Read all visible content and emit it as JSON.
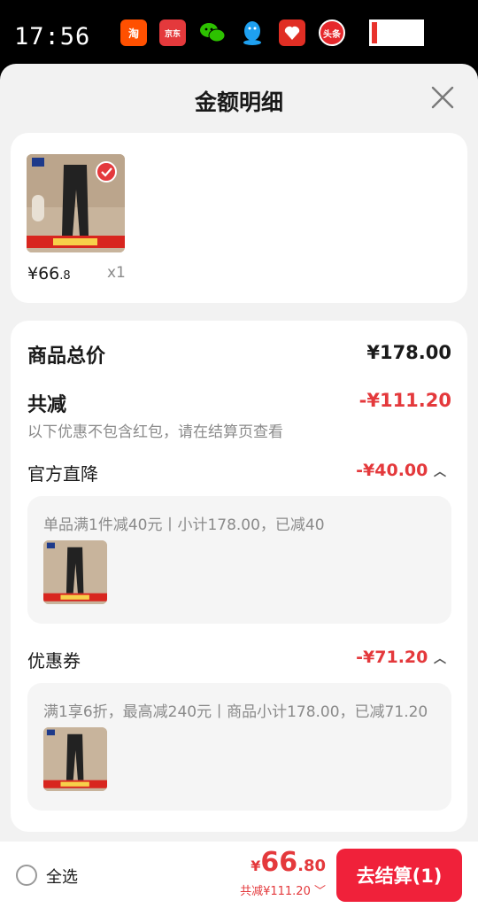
{
  "status_bar": {
    "time": "17:56",
    "apps": [
      {
        "name": "taobao-icon",
        "label": "淘",
        "color": "#ff5000"
      },
      {
        "name": "jd-icon",
        "label": "京东",
        "color": "#e4393c"
      },
      {
        "name": "wechat-icon",
        "label": "",
        "color": "#2dc100"
      },
      {
        "name": "qq-icon",
        "label": "",
        "color": "#1ea0f0"
      },
      {
        "name": "pinduoduo-icon",
        "label": "",
        "color": "#e02e24"
      },
      {
        "name": "toutiao-icon",
        "label": "头条",
        "color": "#e6282c"
      }
    ]
  },
  "sheet": {
    "title": "金额明细"
  },
  "product_card": {
    "price_int": "¥66",
    "price_dec": ".8",
    "qty": "x1"
  },
  "detail": {
    "total_label": "商品总价",
    "total_value": "¥178.00",
    "reduce_label": "共减",
    "reduce_value": "-¥111.20",
    "note": "以下优惠不包含红包，请在结算页查看",
    "official_label": "官方直降",
    "official_value": "-¥40.00",
    "official_desc": "单品满1件减40元丨小计178.00，已减40",
    "coupon_label": "优惠券",
    "coupon_value": "-¥71.20",
    "coupon_desc": "满1享6折，最高减240元丨商品小计178.00，已减71.20"
  },
  "bottom": {
    "select_all": "全选",
    "price_cur": "¥",
    "price_int": "66",
    "price_dec": ".80",
    "saved": "共减¥111.20",
    "checkout": "去结算(1)"
  },
  "colors": {
    "accent_red": "#e4393c",
    "checkout_bg": "#f0213a"
  }
}
